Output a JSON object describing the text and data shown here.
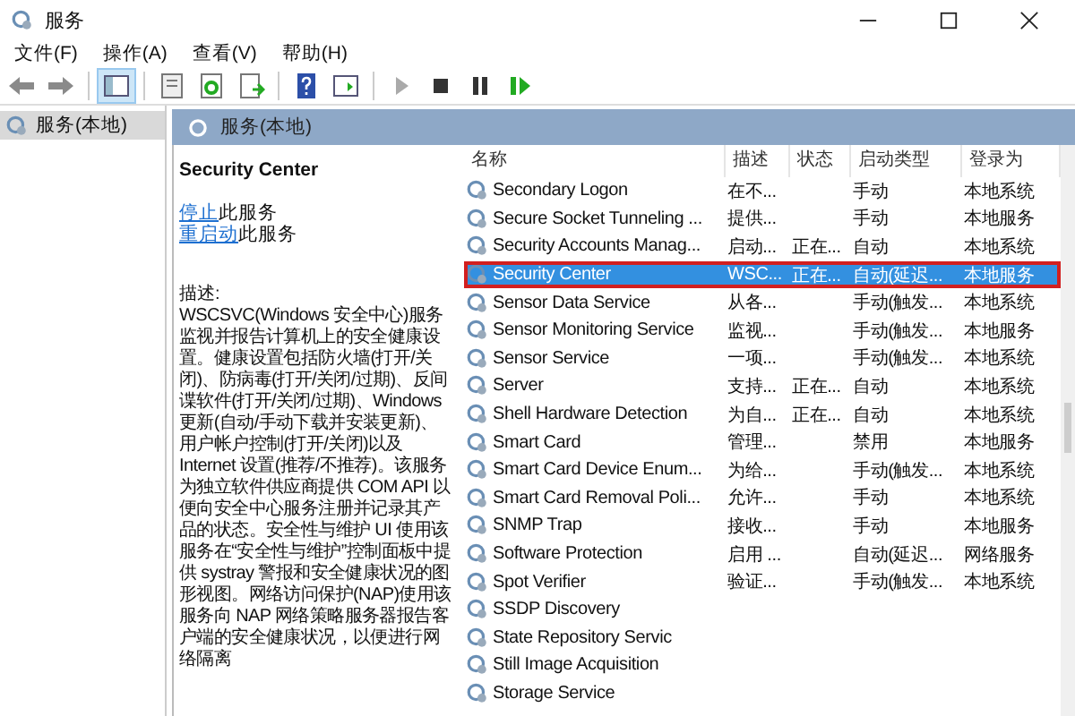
{
  "window": {
    "title": "服务"
  },
  "menu": [
    "文件(F)",
    "操作(A)",
    "查看(V)",
    "帮助(H)"
  ],
  "toolbar": [
    {
      "kind": "back",
      "selected": false
    },
    {
      "kind": "forward",
      "selected": false
    },
    {
      "kind": "sep"
    },
    {
      "kind": "tree",
      "selected": true
    },
    {
      "kind": "sep"
    },
    {
      "kind": "properties",
      "selected": false
    },
    {
      "kind": "refresh",
      "selected": false
    },
    {
      "kind": "export",
      "selected": false
    },
    {
      "kind": "sep"
    },
    {
      "kind": "help",
      "selected": false
    },
    {
      "kind": "pane",
      "selected": false
    },
    {
      "kind": "sep"
    },
    {
      "kind": "play",
      "selected": false
    },
    {
      "kind": "stop",
      "selected": false
    },
    {
      "kind": "pause",
      "selected": false
    },
    {
      "kind": "resume",
      "selected": false
    }
  ],
  "sidebar": {
    "items": [
      {
        "label": "服务(本地)",
        "selected": true
      }
    ]
  },
  "pane_header": "服务(本地)",
  "details": {
    "title": "Security Center",
    "actions": [
      {
        "link": "停止",
        "text": "此服务"
      },
      {
        "link": "重启动",
        "text": "此服务"
      }
    ],
    "description_label": "描述:",
    "description": "WSCSVC(Windows 安全中心)服务监视并报告计算机上的安全健康设置。健康设置包括防火墙(打开/关闭)、防病毒(打开/关闭/过期)、反间谍软件(打开/关闭/过期)、Windows 更新(自动/手动下载并安装更新)、用户帐户控制(打开/关闭)以及 Internet 设置(推荐/不推荐)。该服务为独立软件供应商提供 COM API 以便向安全中心服务注册并记录其产品的状态。安全性与维护 UI 使用该服务在“安全性与维护”控制面板中提供 systray 警报和安全健康状况的图形视图。网络访问保护(NAP)使用该服务向 NAP 网络策略服务器报告客户端的安全健康状况，以便进行网络隔离"
  },
  "table": {
    "columns": [
      "名称",
      "描述",
      "状态",
      "启动类型",
      "登录为"
    ],
    "rows": [
      {
        "cells": [
          "Secondary Logon",
          "在不...",
          "",
          "手动",
          "本地系统"
        ],
        "selected": false,
        "outlined": false
      },
      {
        "cells": [
          "Secure Socket Tunneling ...",
          "提供...",
          "",
          "手动",
          "本地服务"
        ],
        "selected": false,
        "outlined": false
      },
      {
        "cells": [
          "Security Accounts Manag...",
          "启动...",
          "正在...",
          "自动",
          "本地系统"
        ],
        "selected": false,
        "outlined": false
      },
      {
        "cells": [
          "Security Center",
          "WSC...",
          "正在...",
          "自动(延迟...",
          "本地服务"
        ],
        "selected": true,
        "outlined": true
      },
      {
        "cells": [
          "Sensor Data Service",
          "从各...",
          "",
          "手动(触发...",
          "本地系统"
        ],
        "selected": false,
        "outlined": false
      },
      {
        "cells": [
          "Sensor Monitoring Service",
          "监视...",
          "",
          "手动(触发...",
          "本地服务"
        ],
        "selected": false,
        "outlined": false
      },
      {
        "cells": [
          "Sensor Service",
          "一项...",
          "",
          "手动(触发...",
          "本地系统"
        ],
        "selected": false,
        "outlined": false
      },
      {
        "cells": [
          "Server",
          "支持...",
          "正在...",
          "自动",
          "本地系统"
        ],
        "selected": false,
        "outlined": false
      },
      {
        "cells": [
          "Shell Hardware Detection",
          "为自...",
          "正在...",
          "自动",
          "本地系统"
        ],
        "selected": false,
        "outlined": false
      },
      {
        "cells": [
          "Smart Card",
          "管理...",
          "",
          "禁用",
          "本地服务"
        ],
        "selected": false,
        "outlined": false
      },
      {
        "cells": [
          "Smart Card Device Enum...",
          "为给...",
          "",
          "手动(触发...",
          "本地系统"
        ],
        "selected": false,
        "outlined": false
      },
      {
        "cells": [
          "Smart Card Removal Poli...",
          "允许...",
          "",
          "手动",
          "本地系统"
        ],
        "selected": false,
        "outlined": false
      },
      {
        "cells": [
          "SNMP Trap",
          "接收...",
          "",
          "手动",
          "本地服务"
        ],
        "selected": false,
        "outlined": false
      },
      {
        "cells": [
          "Software Protection",
          "启用 ...",
          "",
          "自动(延迟...",
          "网络服务"
        ],
        "selected": false,
        "outlined": false
      },
      {
        "cells": [
          "Spot Verifier",
          "验证...",
          "",
          "手动(触发...",
          "本地系统"
        ],
        "selected": false,
        "outlined": false
      },
      {
        "cells": [
          "SSDP Discovery",
          "",
          "",
          "",
          ""
        ],
        "selected": false,
        "outlined": false
      },
      {
        "cells": [
          "State Repository Servic",
          "",
          "",
          "",
          ""
        ],
        "selected": false,
        "outlined": false
      },
      {
        "cells": [
          "Still Image Acquisition",
          "",
          "",
          "",
          ""
        ],
        "selected": false,
        "outlined": false
      },
      {
        "cells": [
          "Storage Service",
          "",
          "",
          "",
          ""
        ],
        "selected": false,
        "outlined": false
      }
    ]
  }
}
